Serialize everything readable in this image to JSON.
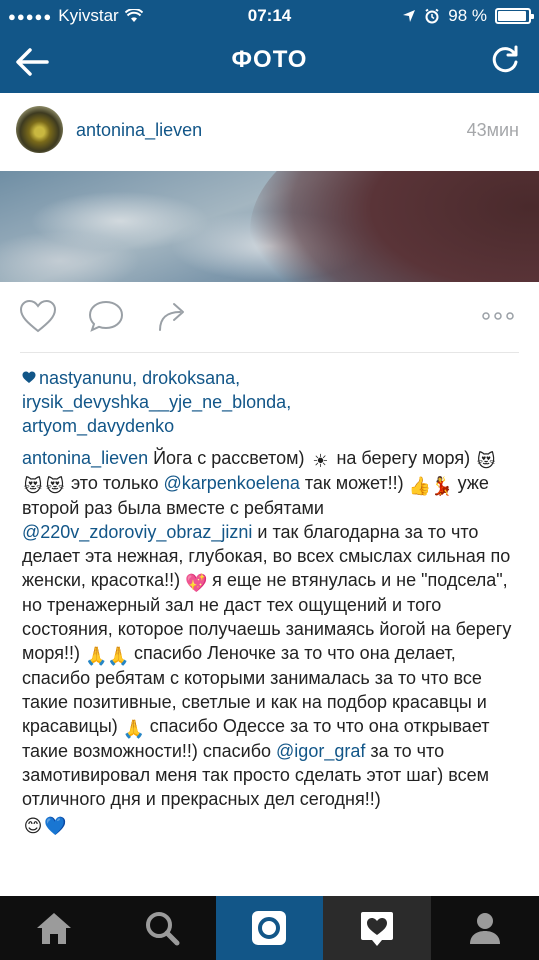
{
  "status_bar": {
    "carrier": "Kyivstar",
    "time": "07:14",
    "battery": "98 %"
  },
  "header": {
    "title": "ФОТО"
  },
  "post": {
    "username": "antonina_lieven",
    "time_ago": "43мин"
  },
  "likes": {
    "users": [
      "nastyanunu",
      "drokoksana",
      "irysik_devyshka__yje_ne_blonda",
      "artyom_davydenko"
    ]
  },
  "caption": {
    "author": "antonina_lieven",
    "t1": " Йога с рассветом) ",
    "t2": " на берегу моря) ",
    "t3": " это только ",
    "mention1": "@karpenkoelena",
    "t4": " так может!!) ",
    "t5": " уже второй раз была вместе с ребятами ",
    "mention2": "@220v_zdoroviy_obraz_jizni",
    "t6": "  и так благодарна за то что делает эта нежная, глубокая, во всех смыслах сильная по женски, красотка!!) ",
    "t7": " я еще не втянулась и не \"подсела\", но тренажерный зал не даст тех ощущений и того состояния, которое получаешь занимаясь йогой на берегу моря!!) ",
    "t8": " спасибо Леночке за то что она делает, спасибо ребятам с которыми занималась за то что все такие позитивные, светлые и как на подбор красавцы и красавицы) ",
    "t9": " спасибо Одессе за то что она открывает такие возможности!!) спасибо ",
    "mention3": "@igor_graf",
    "t10": " за то что замотивировал меня так просто сделать этот шаг) всем отличного дня и прекрасных дел сегодня!!)"
  },
  "colors": {
    "brand_blue": "#125688",
    "nav_bg": "#0f0f0f"
  }
}
